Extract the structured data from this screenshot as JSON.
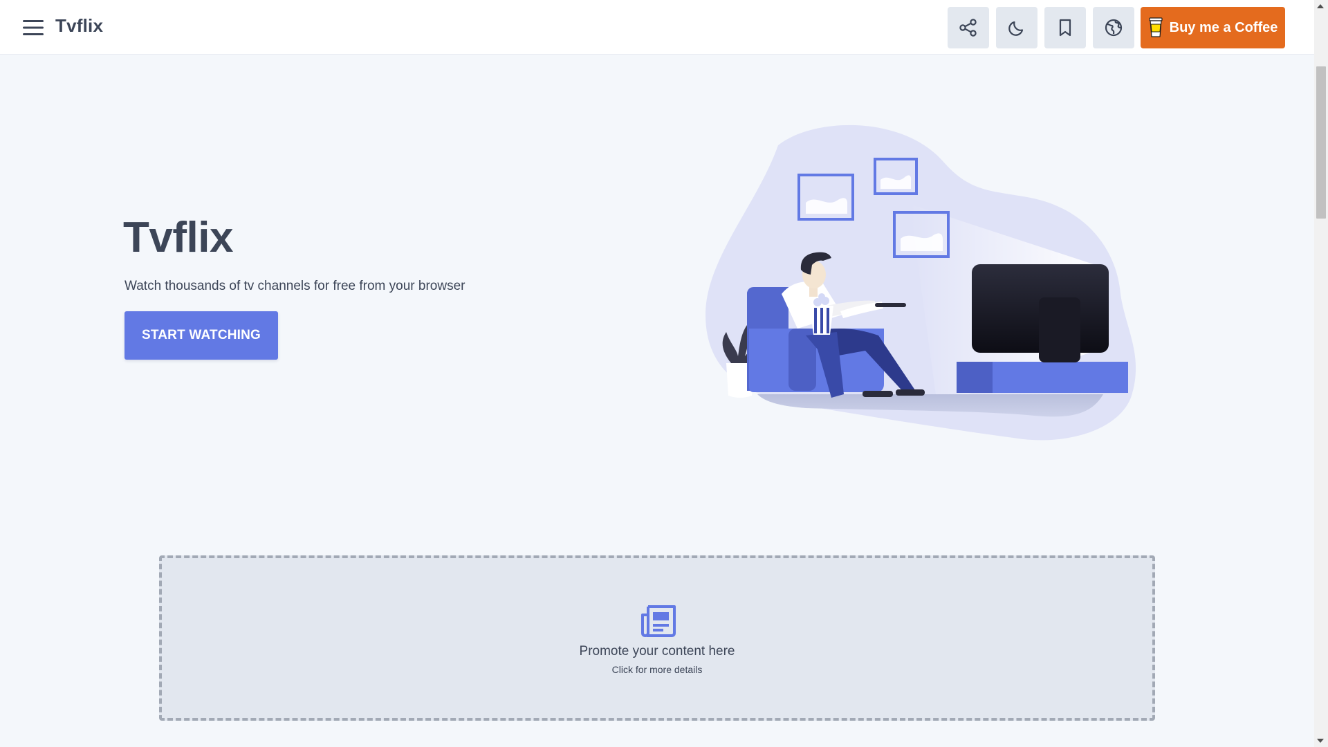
{
  "header": {
    "brand": "Tvflix",
    "coffee_label": "Buy me a Coffee"
  },
  "hero": {
    "title": "Tvflix",
    "subtitle": "Watch thousands of tv channels for free from your browser",
    "cta_label": "START WATCHING"
  },
  "promo": {
    "title": "Promote your content here",
    "subtitle": "Click for more details"
  },
  "icons": {
    "menu": "hamburger-menu-icon",
    "share": "share-icon",
    "theme": "moon-icon",
    "bookmark": "bookmark-icon",
    "language": "globe-icon",
    "coffee": "coffee-cup-icon",
    "promo": "newspaper-icon"
  },
  "colors": {
    "accent": "#6279e4",
    "coffee": "#e46b1e",
    "background": "#f4f7fb",
    "text": "#3c4557",
    "icon_button_bg": "#e3e8ef",
    "promo_bg": "#e2e7ef"
  }
}
